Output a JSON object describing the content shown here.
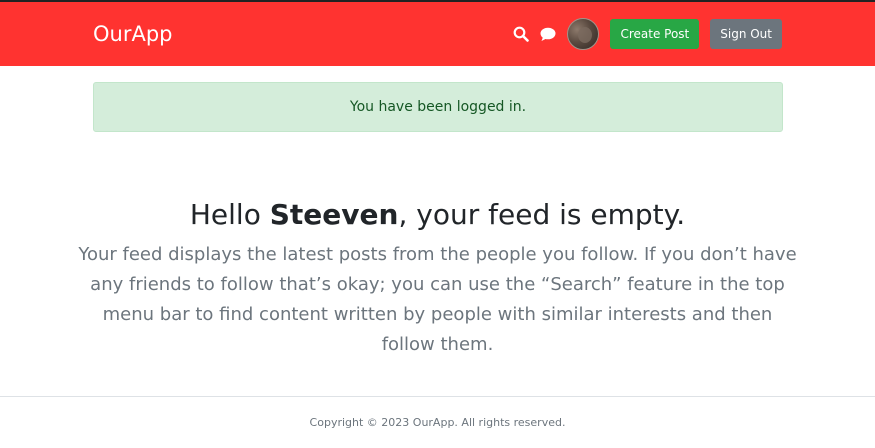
{
  "navbar": {
    "brand": "OurApp",
    "create_post_label": "Create Post",
    "sign_out_label": "Sign Out",
    "search_icon": "search-icon",
    "chat_icon": "chat-icon",
    "brand_color": "#ff3330"
  },
  "alert": {
    "message": "You have been logged in.",
    "color": "#d4edda"
  },
  "feed": {
    "greeting_prefix": "Hello ",
    "username": "Steeven",
    "greeting_suffix": ", your feed is empty.",
    "description": "Your feed displays the latest posts from the people you follow. If you don’t have any friends to follow that’s okay; you can use the “Search” feature in the top menu bar to find content written by people with similar interests and then follow them."
  },
  "footer": {
    "copyright": "Copyright © 2023 OurApp. All rights reserved."
  }
}
